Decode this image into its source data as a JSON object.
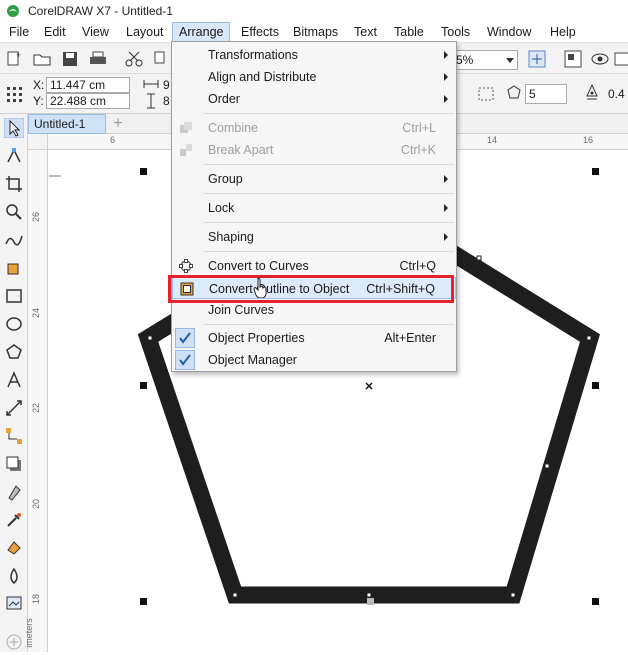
{
  "app": {
    "title": "CorelDRAW X7 - Untitled-1"
  },
  "menubar": {
    "items": [
      "File",
      "Edit",
      "View",
      "Layout",
      "Arrange",
      "Effects",
      "Bitmaps",
      "Text",
      "Table",
      "Tools",
      "Window",
      "Help"
    ],
    "active": "Arrange"
  },
  "toolbar": {
    "zoom_value": "5%"
  },
  "propbar": {
    "x_label": "X:",
    "x_value": "11.447 cm",
    "y_label": "Y:",
    "y_value": "22.488 cm",
    "w_value_partial": "9",
    "h_value_partial": "8",
    "sides_value": "5",
    "outline_value": "0.4"
  },
  "document_tab": {
    "label": "Untitled-1",
    "add_label": "+"
  },
  "rulers": {
    "h_ticks": [
      "6",
      "14",
      "16"
    ],
    "v_ticks": [
      "26",
      "24",
      "22",
      "20",
      "18"
    ],
    "v_unit": "imeters"
  },
  "arrange_menu": {
    "items": [
      {
        "label": "Transformations",
        "submenu": true,
        "enabled": true
      },
      {
        "label": "Align and Distribute",
        "submenu": true,
        "enabled": true
      },
      {
        "label": "Order",
        "submenu": true,
        "enabled": true
      },
      {
        "label": "Combine",
        "shortcut": "Ctrl+L",
        "enabled": false,
        "icon": "combine-icon"
      },
      {
        "label": "Break Apart",
        "shortcut": "Ctrl+K",
        "enabled": false,
        "icon": "break-apart-icon"
      },
      {
        "label": "Group",
        "submenu": true,
        "enabled": true
      },
      {
        "label": "Lock",
        "submenu": true,
        "enabled": true
      },
      {
        "label": "Shaping",
        "submenu": true,
        "enabled": true
      },
      {
        "label": "Convert to Curves",
        "shortcut": "Ctrl+Q",
        "enabled": true,
        "icon": "convert-to-curves-icon"
      },
      {
        "label": "Convert Outline to Object",
        "shortcut": "Ctrl+Shift+Q",
        "enabled": true,
        "icon": "convert-outline-icon",
        "hovered": true
      },
      {
        "label": "Join Curves",
        "enabled": true
      },
      {
        "label": "Object Properties",
        "shortcut": "Alt+Enter",
        "enabled": true,
        "checked": true
      },
      {
        "label": "Object Manager",
        "enabled": true,
        "checked": true
      }
    ]
  },
  "colors": {
    "highlight_border": "#e8222d",
    "hover_bg": "#dcebfb",
    "shape_stroke": "#1e1e1e"
  }
}
